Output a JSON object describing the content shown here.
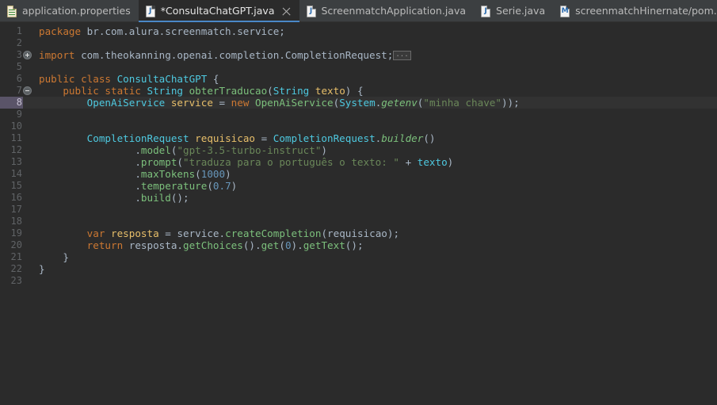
{
  "window": {
    "title": "ConsultaChatGPT.java",
    "theme": "darcula"
  },
  "colors": {
    "editor_bg": "#2b2b2b",
    "tabbar_bg": "#3c3f41",
    "active_tab_underline": "#4a88c7",
    "current_line_bg": "#323232",
    "current_line_number_bg": "#5a5468",
    "keyword": "#cc7832",
    "string": "#6a8759",
    "number": "#6897bb",
    "class_name": "#4ec9e0",
    "method": "#7cc07c",
    "field": "#9876aa",
    "variable": "#e8bf6a",
    "plain_text": "#a9b7c6",
    "line_number": "#606366"
  },
  "tabs": [
    {
      "label": "application.properties",
      "icon": "properties-file-icon",
      "icon_glyph": "",
      "active": false,
      "modified": false,
      "closable": false
    },
    {
      "label": "*ConsultaChatGPT.java",
      "icon": "java-file-icon",
      "icon_glyph": "J",
      "active": true,
      "modified": true,
      "closable": true
    },
    {
      "label": "ScreenmatchApplication.java",
      "icon": "java-file-icon",
      "icon_glyph": "J",
      "active": false,
      "modified": false,
      "closable": false
    },
    {
      "label": "Serie.java",
      "icon": "java-file-icon",
      "icon_glyph": "J",
      "active": false,
      "modified": false,
      "closable": false
    },
    {
      "label": "screenmatchHinernate/pom.xml",
      "icon": "maven-file-icon",
      "icon_glyph": "M",
      "active": false,
      "modified": false,
      "closable": false
    }
  ],
  "editor": {
    "current_line": 8,
    "fold_collapsed_placeholder": "...",
    "lines": [
      {
        "number": "1",
        "fold": null,
        "current": false,
        "tokens": [
          {
            "t": "package ",
            "c": "kw"
          },
          {
            "t": "br.com.alura.screenmatch.service;",
            "c": "pln"
          }
        ]
      },
      {
        "number": "2",
        "fold": null,
        "current": false,
        "tokens": []
      },
      {
        "number": "3",
        "fold": "plus",
        "current": false,
        "tokens": [
          {
            "t": "import ",
            "c": "kw"
          },
          {
            "t": "com.theokanning.openai.completion.CompletionRequest;",
            "c": "pln"
          },
          {
            "t": "...",
            "c": "foldbox"
          }
        ]
      },
      {
        "number": "5",
        "fold": null,
        "current": false,
        "tokens": []
      },
      {
        "number": "6",
        "fold": null,
        "current": false,
        "tokens": [
          {
            "t": "public class ",
            "c": "kw"
          },
          {
            "t": "ConsultaChatGPT",
            "c": "cls"
          },
          {
            "t": " {",
            "c": "pln"
          }
        ]
      },
      {
        "number": "7",
        "fold": "minus",
        "current": false,
        "tokens": [
          {
            "t": "    ",
            "c": "pln"
          },
          {
            "t": "public static ",
            "c": "kw"
          },
          {
            "t": "String",
            "c": "cls"
          },
          {
            "t": " ",
            "c": "pln"
          },
          {
            "t": "obterTraducao",
            "c": "mth"
          },
          {
            "t": "(",
            "c": "pln"
          },
          {
            "t": "String",
            "c": "cls"
          },
          {
            "t": " ",
            "c": "pln"
          },
          {
            "t": "texto",
            "c": "var"
          },
          {
            "t": ") {",
            "c": "pln"
          }
        ]
      },
      {
        "number": "8",
        "fold": null,
        "current": true,
        "tokens": [
          {
            "t": "        ",
            "c": "pln"
          },
          {
            "t": "OpenAiService",
            "c": "cls"
          },
          {
            "t": " ",
            "c": "pln"
          },
          {
            "t": "service",
            "c": "var"
          },
          {
            "t": " = ",
            "c": "pln"
          },
          {
            "t": "new ",
            "c": "kw"
          },
          {
            "t": "OpenAiService",
            "c": "mth"
          },
          {
            "t": "(",
            "c": "pln"
          },
          {
            "t": "System",
            "c": "cls"
          },
          {
            "t": ".",
            "c": "pln"
          },
          {
            "t": "getenv",
            "c": "statm"
          },
          {
            "t": "(",
            "c": "pln"
          },
          {
            "t": "\"minha chave\"",
            "c": "str"
          },
          {
            "t": "));",
            "c": "pln"
          }
        ]
      },
      {
        "number": "9",
        "fold": null,
        "current": false,
        "tokens": []
      },
      {
        "number": "10",
        "fold": null,
        "current": false,
        "tokens": []
      },
      {
        "number": "11",
        "fold": null,
        "current": false,
        "tokens": [
          {
            "t": "        ",
            "c": "pln"
          },
          {
            "t": "CompletionRequest",
            "c": "cls"
          },
          {
            "t": " ",
            "c": "pln"
          },
          {
            "t": "requisicao",
            "c": "var"
          },
          {
            "t": " = ",
            "c": "pln"
          },
          {
            "t": "CompletionRequest",
            "c": "cls"
          },
          {
            "t": ".",
            "c": "pln"
          },
          {
            "t": "builder",
            "c": "statm"
          },
          {
            "t": "()",
            "c": "pln"
          }
        ]
      },
      {
        "number": "12",
        "fold": null,
        "current": false,
        "tokens": [
          {
            "t": "                ",
            "c": "pln"
          },
          {
            "t": ".",
            "c": "pln"
          },
          {
            "t": "model",
            "c": "mth"
          },
          {
            "t": "(",
            "c": "pln"
          },
          {
            "t": "\"gpt-3.5-turbo-instruct\"",
            "c": "str"
          },
          {
            "t": ")",
            "c": "pln"
          }
        ]
      },
      {
        "number": "13",
        "fold": null,
        "current": false,
        "tokens": [
          {
            "t": "                ",
            "c": "pln"
          },
          {
            "t": ".",
            "c": "pln"
          },
          {
            "t": "prompt",
            "c": "mth"
          },
          {
            "t": "(",
            "c": "pln"
          },
          {
            "t": "\"traduza para o português o texto: \"",
            "c": "str"
          },
          {
            "t": " + ",
            "c": "pln"
          },
          {
            "t": "texto",
            "c": "cls"
          },
          {
            "t": ")",
            "c": "pln"
          }
        ]
      },
      {
        "number": "14",
        "fold": null,
        "current": false,
        "tokens": [
          {
            "t": "                ",
            "c": "pln"
          },
          {
            "t": ".",
            "c": "pln"
          },
          {
            "t": "maxTokens",
            "c": "mth"
          },
          {
            "t": "(",
            "c": "pln"
          },
          {
            "t": "1000",
            "c": "num"
          },
          {
            "t": ")",
            "c": "pln"
          }
        ]
      },
      {
        "number": "15",
        "fold": null,
        "current": false,
        "tokens": [
          {
            "t": "                ",
            "c": "pln"
          },
          {
            "t": ".",
            "c": "pln"
          },
          {
            "t": "temperature",
            "c": "mth"
          },
          {
            "t": "(",
            "c": "pln"
          },
          {
            "t": "0.7",
            "c": "num"
          },
          {
            "t": ")",
            "c": "pln"
          }
        ]
      },
      {
        "number": "16",
        "fold": null,
        "current": false,
        "tokens": [
          {
            "t": "                ",
            "c": "pln"
          },
          {
            "t": ".",
            "c": "pln"
          },
          {
            "t": "build",
            "c": "mth"
          },
          {
            "t": "();",
            "c": "pln"
          }
        ]
      },
      {
        "number": "17",
        "fold": null,
        "current": false,
        "tokens": []
      },
      {
        "number": "18",
        "fold": null,
        "current": false,
        "tokens": []
      },
      {
        "number": "19",
        "fold": null,
        "current": false,
        "tokens": [
          {
            "t": "        ",
            "c": "pln"
          },
          {
            "t": "var ",
            "c": "kw"
          },
          {
            "t": "resposta",
            "c": "var"
          },
          {
            "t": " = ",
            "c": "pln"
          },
          {
            "t": "service",
            "c": "pln"
          },
          {
            "t": ".",
            "c": "pln"
          },
          {
            "t": "createCompletion",
            "c": "mth"
          },
          {
            "t": "(",
            "c": "pln"
          },
          {
            "t": "requisicao",
            "c": "pln"
          },
          {
            "t": ");",
            "c": "pln"
          }
        ]
      },
      {
        "number": "20",
        "fold": null,
        "current": false,
        "tokens": [
          {
            "t": "        ",
            "c": "pln"
          },
          {
            "t": "return ",
            "c": "kw"
          },
          {
            "t": "resposta",
            "c": "pln"
          },
          {
            "t": ".",
            "c": "pln"
          },
          {
            "t": "getChoices",
            "c": "mth"
          },
          {
            "t": "().",
            "c": "pln"
          },
          {
            "t": "get",
            "c": "mth"
          },
          {
            "t": "(",
            "c": "pln"
          },
          {
            "t": "0",
            "c": "num"
          },
          {
            "t": ").",
            "c": "pln"
          },
          {
            "t": "getText",
            "c": "mth"
          },
          {
            "t": "();",
            "c": "pln"
          }
        ]
      },
      {
        "number": "21",
        "fold": null,
        "current": false,
        "tokens": [
          {
            "t": "    }",
            "c": "pln"
          }
        ]
      },
      {
        "number": "22",
        "fold": null,
        "current": false,
        "tokens": [
          {
            "t": "}",
            "c": "pln"
          }
        ]
      },
      {
        "number": "23",
        "fold": null,
        "current": false,
        "tokens": []
      }
    ]
  }
}
